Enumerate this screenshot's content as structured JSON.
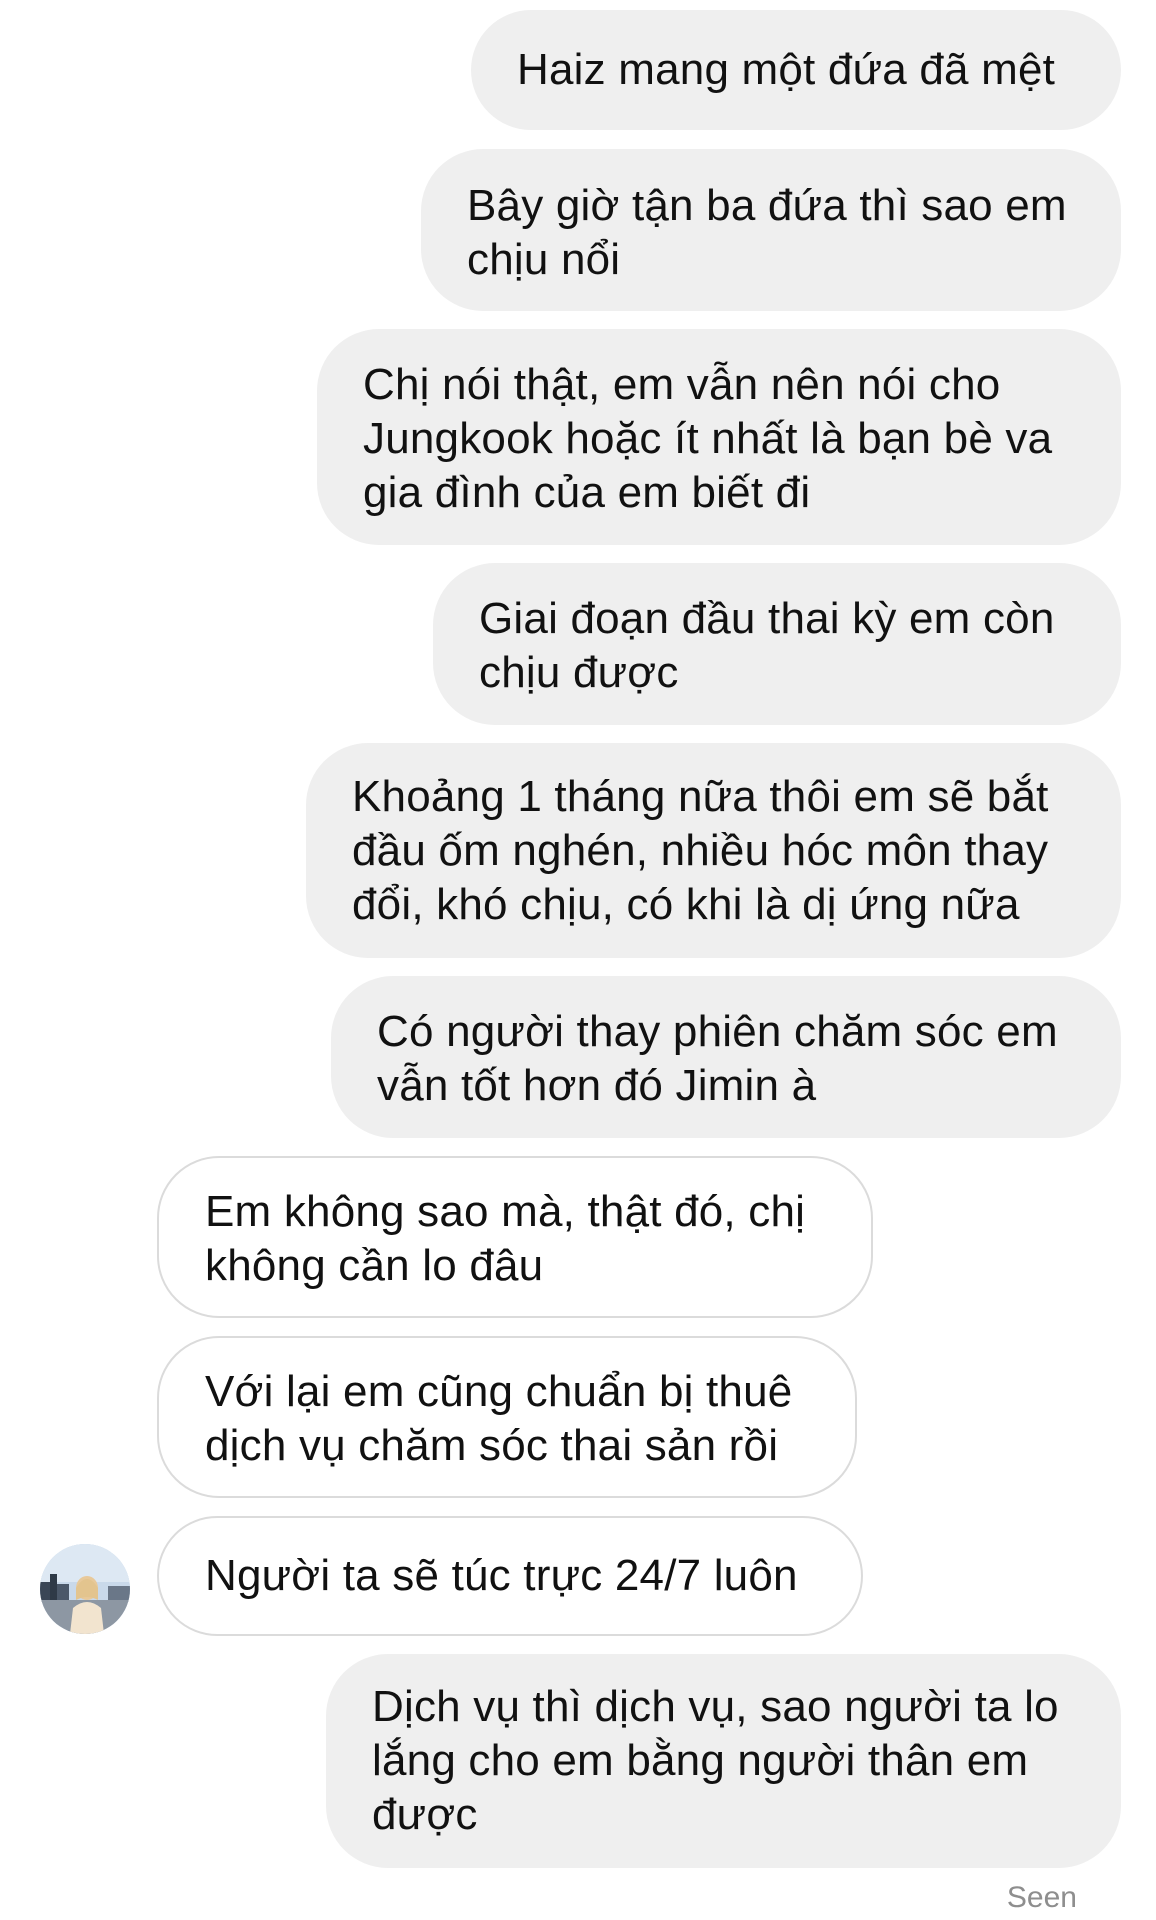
{
  "conversation": {
    "messages": [
      {
        "direction": "sent",
        "text": "Haiz mang một đứa đã mệt"
      },
      {
        "direction": "sent",
        "text": "Bây giờ tận ba đứa thì sao em chịu nổi"
      },
      {
        "direction": "sent",
        "text": "Chị nói thật, em vẫn nên nói cho Jungkook hoặc ít nhất là bạn bè va gia đình của em biết đi"
      },
      {
        "direction": "sent",
        "text": "Giai đoạn đầu thai kỳ em còn chịu được"
      },
      {
        "direction": "sent",
        "text": "Khoảng 1 tháng nữa thôi em sẽ bắt đầu ốm nghén, nhiều hóc môn thay đổi, khó chịu, có khi là dị ứng nữa"
      },
      {
        "direction": "sent",
        "text": "Có người thay phiên chăm sóc em vẫn tốt hơn đó Jimin à"
      },
      {
        "direction": "received",
        "text": "Em không sao mà, thật đó, chị không cần lo đâu"
      },
      {
        "direction": "received",
        "text": "Với lại em cũng chuẩn bị thuê dịch vụ chăm sóc thai sản rồi"
      },
      {
        "direction": "received",
        "text": "Người ta sẽ túc trực 24/7 luôn"
      },
      {
        "direction": "sent",
        "text": "Dịch vụ thì dịch vụ, sao người ta lo lắng cho em bằng người thân em được"
      }
    ],
    "status": "Seen"
  },
  "colors": {
    "sent_bubble": "#efefef",
    "received_border": "#dbdbdb",
    "seen_text": "#8e8e8e"
  },
  "icons": {
    "avatar": "contact-avatar-photo"
  }
}
